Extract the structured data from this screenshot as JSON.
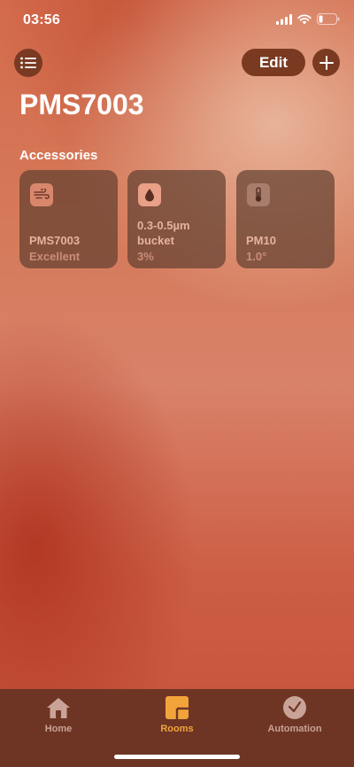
{
  "status_bar": {
    "time": "03:56"
  },
  "header": {
    "edit_label": "Edit"
  },
  "page": {
    "title": "PMS7003",
    "section_label": "Accessories"
  },
  "accessories": [
    {
      "name": "PMS7003",
      "status": "Excellent",
      "icon": "air-quality-icon"
    },
    {
      "name": "0.3-0.5µm bucket",
      "status": "3%",
      "icon": "humidity-drop-icon"
    },
    {
      "name": "PM10",
      "status": "1.0°",
      "icon": "thermometer-icon"
    }
  ],
  "tab_bar": {
    "tabs": [
      {
        "label": "Home",
        "icon": "house-icon",
        "active": false
      },
      {
        "label": "Rooms",
        "icon": "rooms-icon",
        "active": true
      },
      {
        "label": "Automation",
        "icon": "clock-icon",
        "active": false
      }
    ]
  },
  "colors": {
    "accent": "#f2a43a",
    "button_bg": "#7a3a22",
    "tabbar_bg": "#6e3525"
  }
}
